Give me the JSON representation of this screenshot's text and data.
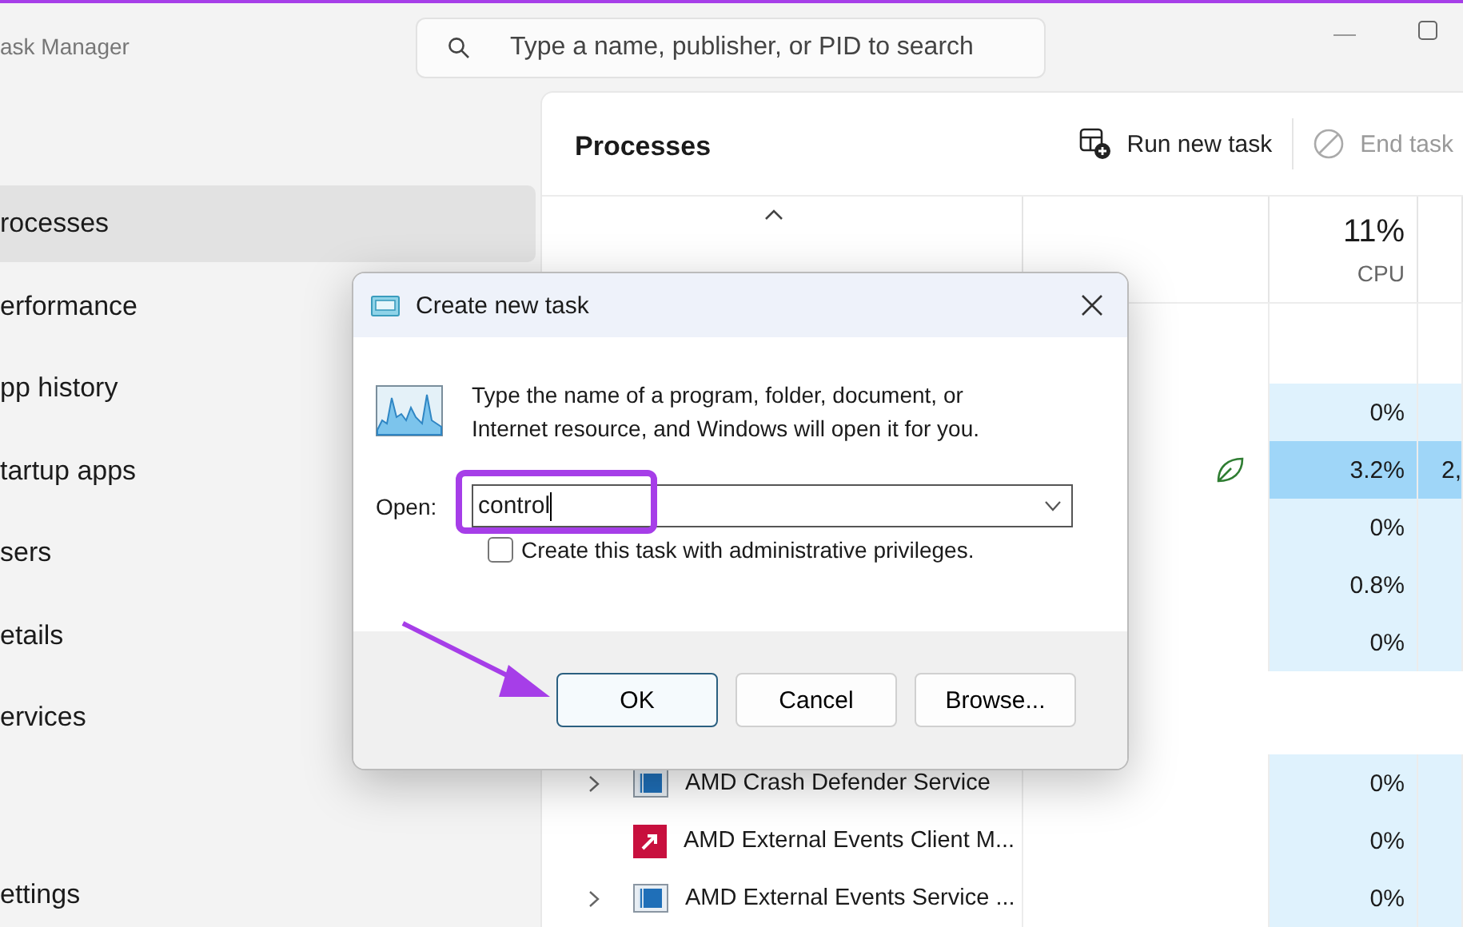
{
  "window": {
    "title": "ask Manager"
  },
  "search": {
    "placeholder": "Type a name, publisher, or PID to search"
  },
  "sidebar": {
    "items": [
      {
        "label": "rocesses",
        "selected": true
      },
      {
        "label": "erformance",
        "selected": false
      },
      {
        "label": "pp history",
        "selected": false
      },
      {
        "label": "tartup apps",
        "selected": false
      },
      {
        "label": "sers",
        "selected": false
      },
      {
        "label": "etails",
        "selected": false
      },
      {
        "label": "ervices",
        "selected": false
      }
    ],
    "footer": "ettings"
  },
  "panel": {
    "title": "Processes",
    "actions": [
      {
        "label": "Run new task",
        "kind": "run",
        "disabled": false
      },
      {
        "label": "End task",
        "kind": "end",
        "disabled": true
      }
    ]
  },
  "table": {
    "cpu_value": "11%",
    "cpu_label": "CPU",
    "rows": [
      {
        "kind": "hidden",
        "cpu": "0%",
        "highlighted": false
      },
      {
        "kind": "hidden",
        "cpu": "3.2%",
        "highlighted": true,
        "eco": true,
        "column_5": "2,"
      },
      {
        "kind": "hidden",
        "cpu": "0%",
        "highlighted": false
      },
      {
        "kind": "hidden",
        "cpu": "0.8%",
        "highlighted": false
      },
      {
        "kind": "hidden",
        "cpu": "0%",
        "highlighted": false
      },
      {
        "kind": "blank"
      },
      {
        "kind": "service",
        "name": "AMD Crash Defender Service",
        "expandable": true,
        "cpu": "0%",
        "highlighted": false
      },
      {
        "kind": "app",
        "name": "AMD External Events Client M...",
        "cpu": "0%",
        "highlighted": false
      },
      {
        "kind": "service",
        "name": "AMD External Events Service ...",
        "expandable": true,
        "cpu": "0%",
        "highlighted": false
      }
    ]
  },
  "dialog": {
    "title": "Create new task",
    "message": [
      "Type the name of a program, folder, document, or",
      "Internet resource, and Windows will open it for you."
    ],
    "open_label": "Open:",
    "value": "control",
    "admin_checkbox": {
      "label": "Create this task with administrative privileges.",
      "checked": false
    },
    "buttons": [
      {
        "label": "OK",
        "default": true
      },
      {
        "label": "Cancel",
        "default": false
      },
      {
        "label": "Browse...",
        "default": false
      }
    ]
  }
}
